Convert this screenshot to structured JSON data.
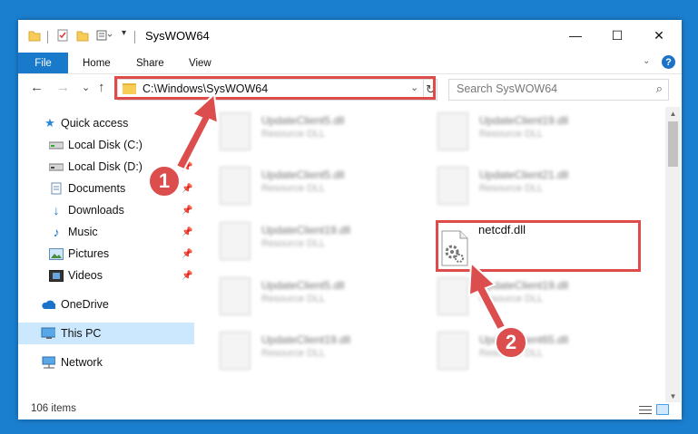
{
  "titlebar": {
    "title": "SysWOW64",
    "minimize_label": "—",
    "maximize_label": "☐",
    "close_label": "✕"
  },
  "ribbon": {
    "tabs": [
      {
        "label": "File"
      },
      {
        "label": "Home"
      },
      {
        "label": "Share"
      },
      {
        "label": "View"
      }
    ],
    "help_label": "?"
  },
  "nav": {
    "back": "←",
    "forward": "→",
    "recent": "⌄",
    "up": "↑",
    "address": "C:\\Windows\\SysWOW64",
    "address_dropdown": "⌄",
    "refresh": "↻",
    "search_placeholder": "Search SysWOW64",
    "search_icon": "⌕"
  },
  "sidebar": {
    "items": [
      {
        "label": "Quick access",
        "icon": "star-icon",
        "pinned": false
      },
      {
        "label": "Local Disk (C:)",
        "icon": "drive-icon",
        "pinned": false
      },
      {
        "label": "Local Disk (D:)",
        "icon": "drive-icon",
        "pinned": true
      },
      {
        "label": "Documents",
        "icon": "documents-icon",
        "pinned": true
      },
      {
        "label": "Downloads",
        "icon": "download-icon",
        "pinned": true
      },
      {
        "label": "Music",
        "icon": "music-icon",
        "pinned": true
      },
      {
        "label": "Pictures",
        "icon": "pictures-icon",
        "pinned": true
      },
      {
        "label": "Videos",
        "icon": "videos-icon",
        "pinned": true
      },
      {
        "label": "OneDrive",
        "icon": "cloud-icon",
        "pinned": false
      },
      {
        "label": "This PC",
        "icon": "computer-icon",
        "pinned": false,
        "selected": true
      },
      {
        "label": "Network",
        "icon": "network-icon",
        "pinned": false
      }
    ],
    "pin_glyph": "📌"
  },
  "files": {
    "blurred": [
      {
        "name": "UpdateClient5.dll",
        "type": "Resource DLL"
      },
      {
        "name": "UpdateClient19.dll",
        "type": "Resource DLL"
      },
      {
        "name": "UpdateClient5.dll",
        "type": "Resource DLL"
      },
      {
        "name": "UpdateClient21.dll",
        "type": "Resource DLL"
      },
      {
        "name": "UpdateClient19.dll",
        "type": "Resource DLL"
      },
      {
        "name": "UpdateClient5.dll",
        "type": "Resource DLL"
      },
      {
        "name": "UpdateClient19.dll",
        "type": "Resource DLL"
      },
      {
        "name": "UpdateClient19.dll",
        "type": "Resource DLL"
      },
      {
        "name": "UpdateClient65.dll",
        "type": "Resource DLL"
      }
    ],
    "highlighted": {
      "name": "netcdf.dll"
    }
  },
  "status": {
    "item_count": "106 items"
  },
  "annotations": {
    "step1": "1",
    "step2": "2",
    "color": "#dc4d4d"
  }
}
